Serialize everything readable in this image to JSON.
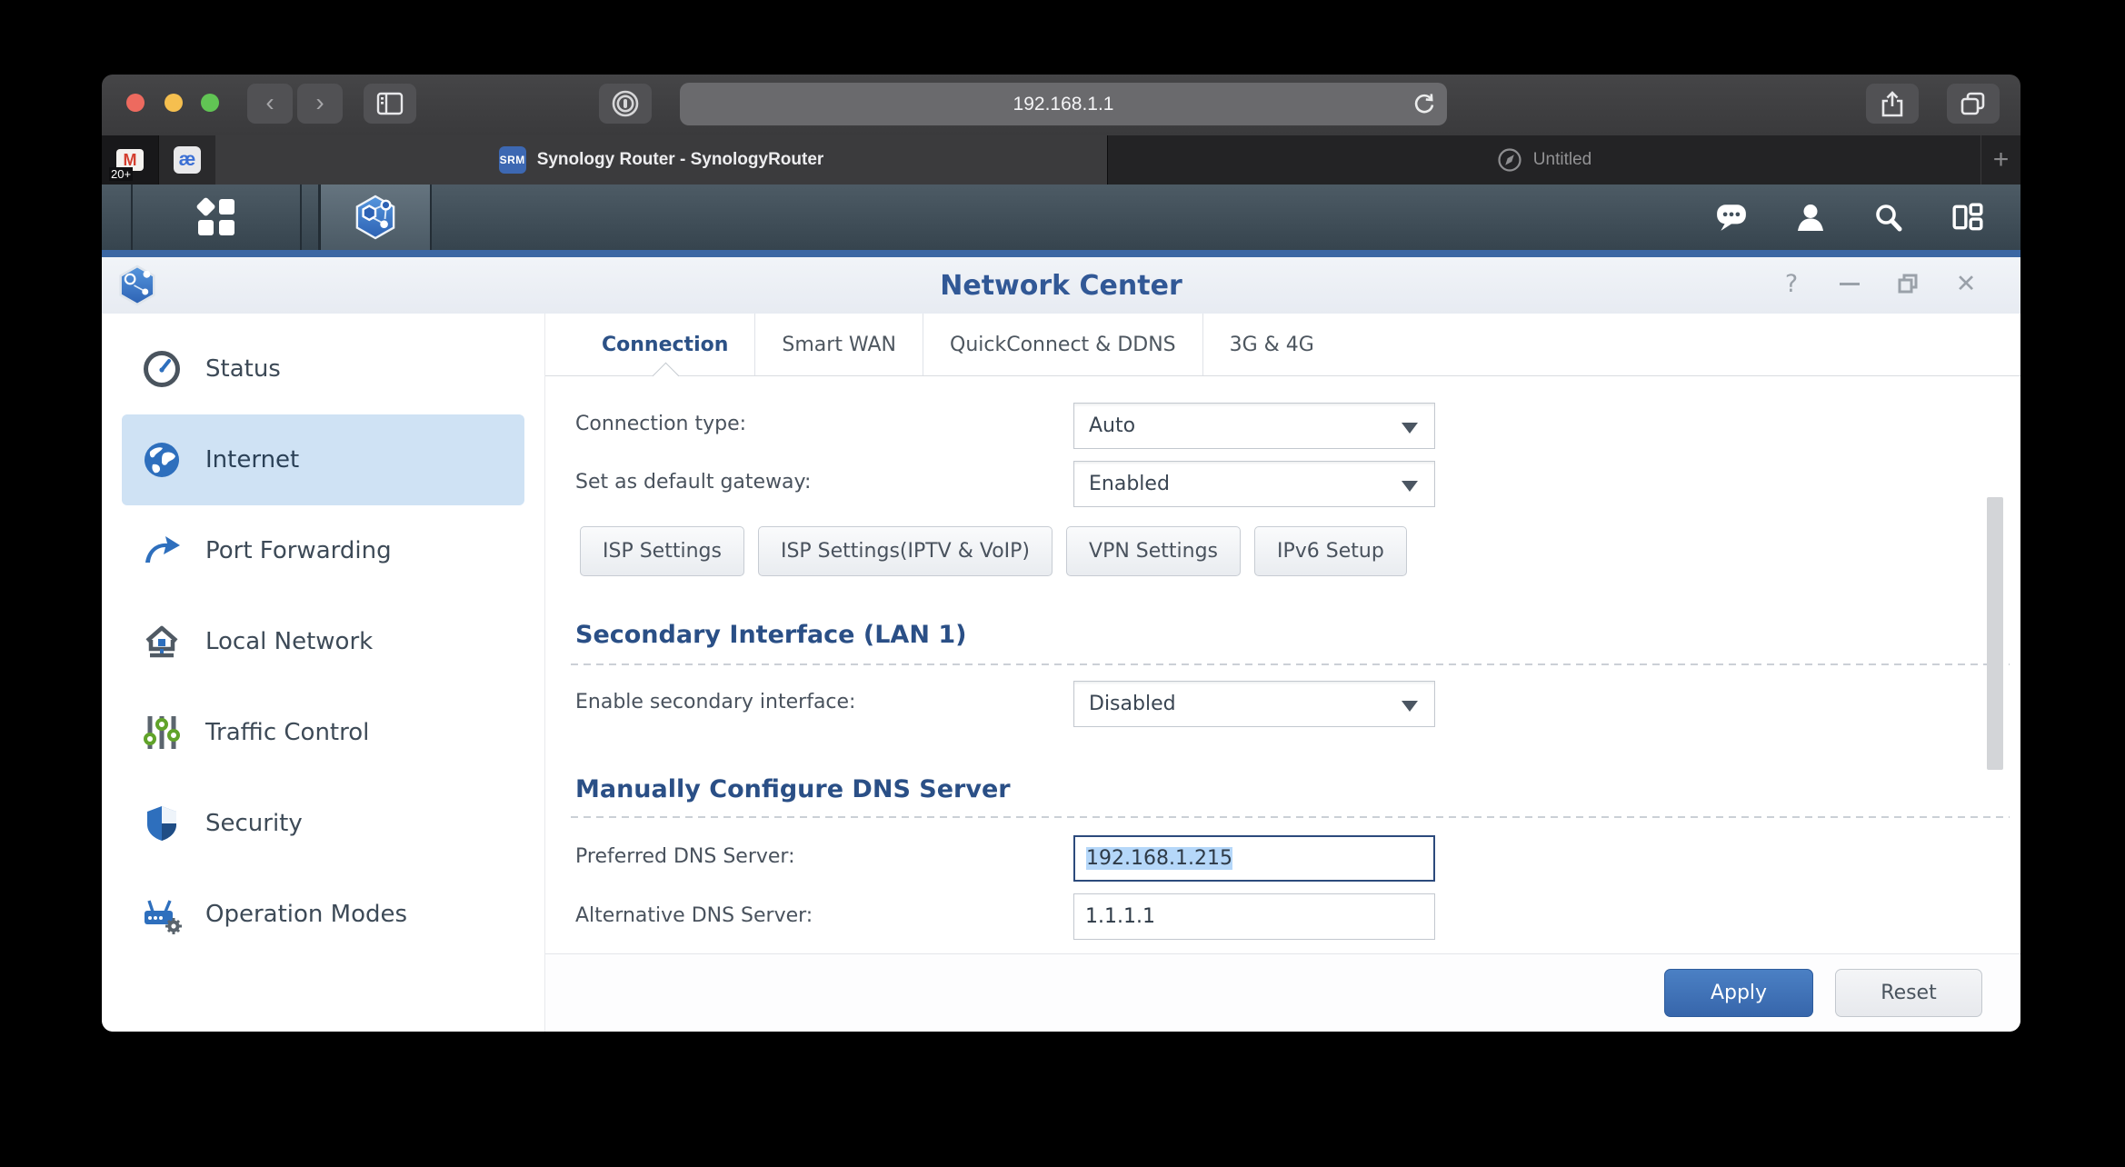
{
  "browser": {
    "url": "192.168.1.1",
    "pinned_tabs": [
      {
        "icon": "gmail",
        "label": "M",
        "badge": "20+"
      },
      {
        "icon": "ae",
        "label": "æ"
      }
    ],
    "tabs": [
      {
        "favicon": "SRM",
        "title": "Synology Router - SynologyRouter",
        "active": true
      },
      {
        "title": "Untitled",
        "active": false
      }
    ],
    "new_tab_label": "+"
  },
  "srm": {
    "window_title": "Network Center",
    "window_controls": {
      "help": "?",
      "close": "✕"
    },
    "sidebar": {
      "items": [
        {
          "label": "Status",
          "icon": "gauge-icon"
        },
        {
          "label": "Internet",
          "icon": "globe-icon",
          "active": true
        },
        {
          "label": "Port Forwarding",
          "icon": "forward-arrow-icon"
        },
        {
          "label": "Local Network",
          "icon": "home-network-icon"
        },
        {
          "label": "Traffic Control",
          "icon": "sliders-icon"
        },
        {
          "label": "Security",
          "icon": "shield-icon"
        },
        {
          "label": "Operation Modes",
          "icon": "router-gear-icon"
        }
      ]
    },
    "tabs": [
      {
        "label": "Connection",
        "active": true
      },
      {
        "label": "Smart WAN"
      },
      {
        "label": "QuickConnect & DDNS"
      },
      {
        "label": "3G & 4G"
      }
    ],
    "form": {
      "connection_type": {
        "label": "Connection type:",
        "value": "Auto"
      },
      "default_gateway": {
        "label": "Set as default gateway:",
        "value": "Enabled"
      },
      "action_buttons": [
        {
          "label": "ISP Settings"
        },
        {
          "label": "ISP Settings(IPTV & VoIP)"
        },
        {
          "label": "VPN Settings"
        },
        {
          "label": "IPv6 Setup"
        }
      ],
      "secondary_section_title": "Secondary Interface (LAN 1)",
      "secondary_interface": {
        "label": "Enable secondary interface:",
        "value": "Disabled"
      },
      "dns_section_title": "Manually Configure DNS Server",
      "preferred_dns": {
        "label": "Preferred DNS Server:",
        "value": "192.168.1.215",
        "text_selected": true
      },
      "alternative_dns": {
        "label": "Alternative DNS Server:",
        "value": "1.1.1.1"
      }
    },
    "footer": {
      "apply_label": "Apply",
      "reset_label": "Reset"
    }
  },
  "appearance": {
    "accent-blue": "#4b80c4",
    "selection-blue": "#b5d7f9",
    "taskbar-line": "#3b67a3",
    "sidebar-active-bg": "#cfe2f4",
    "title-blue": "#315896"
  }
}
